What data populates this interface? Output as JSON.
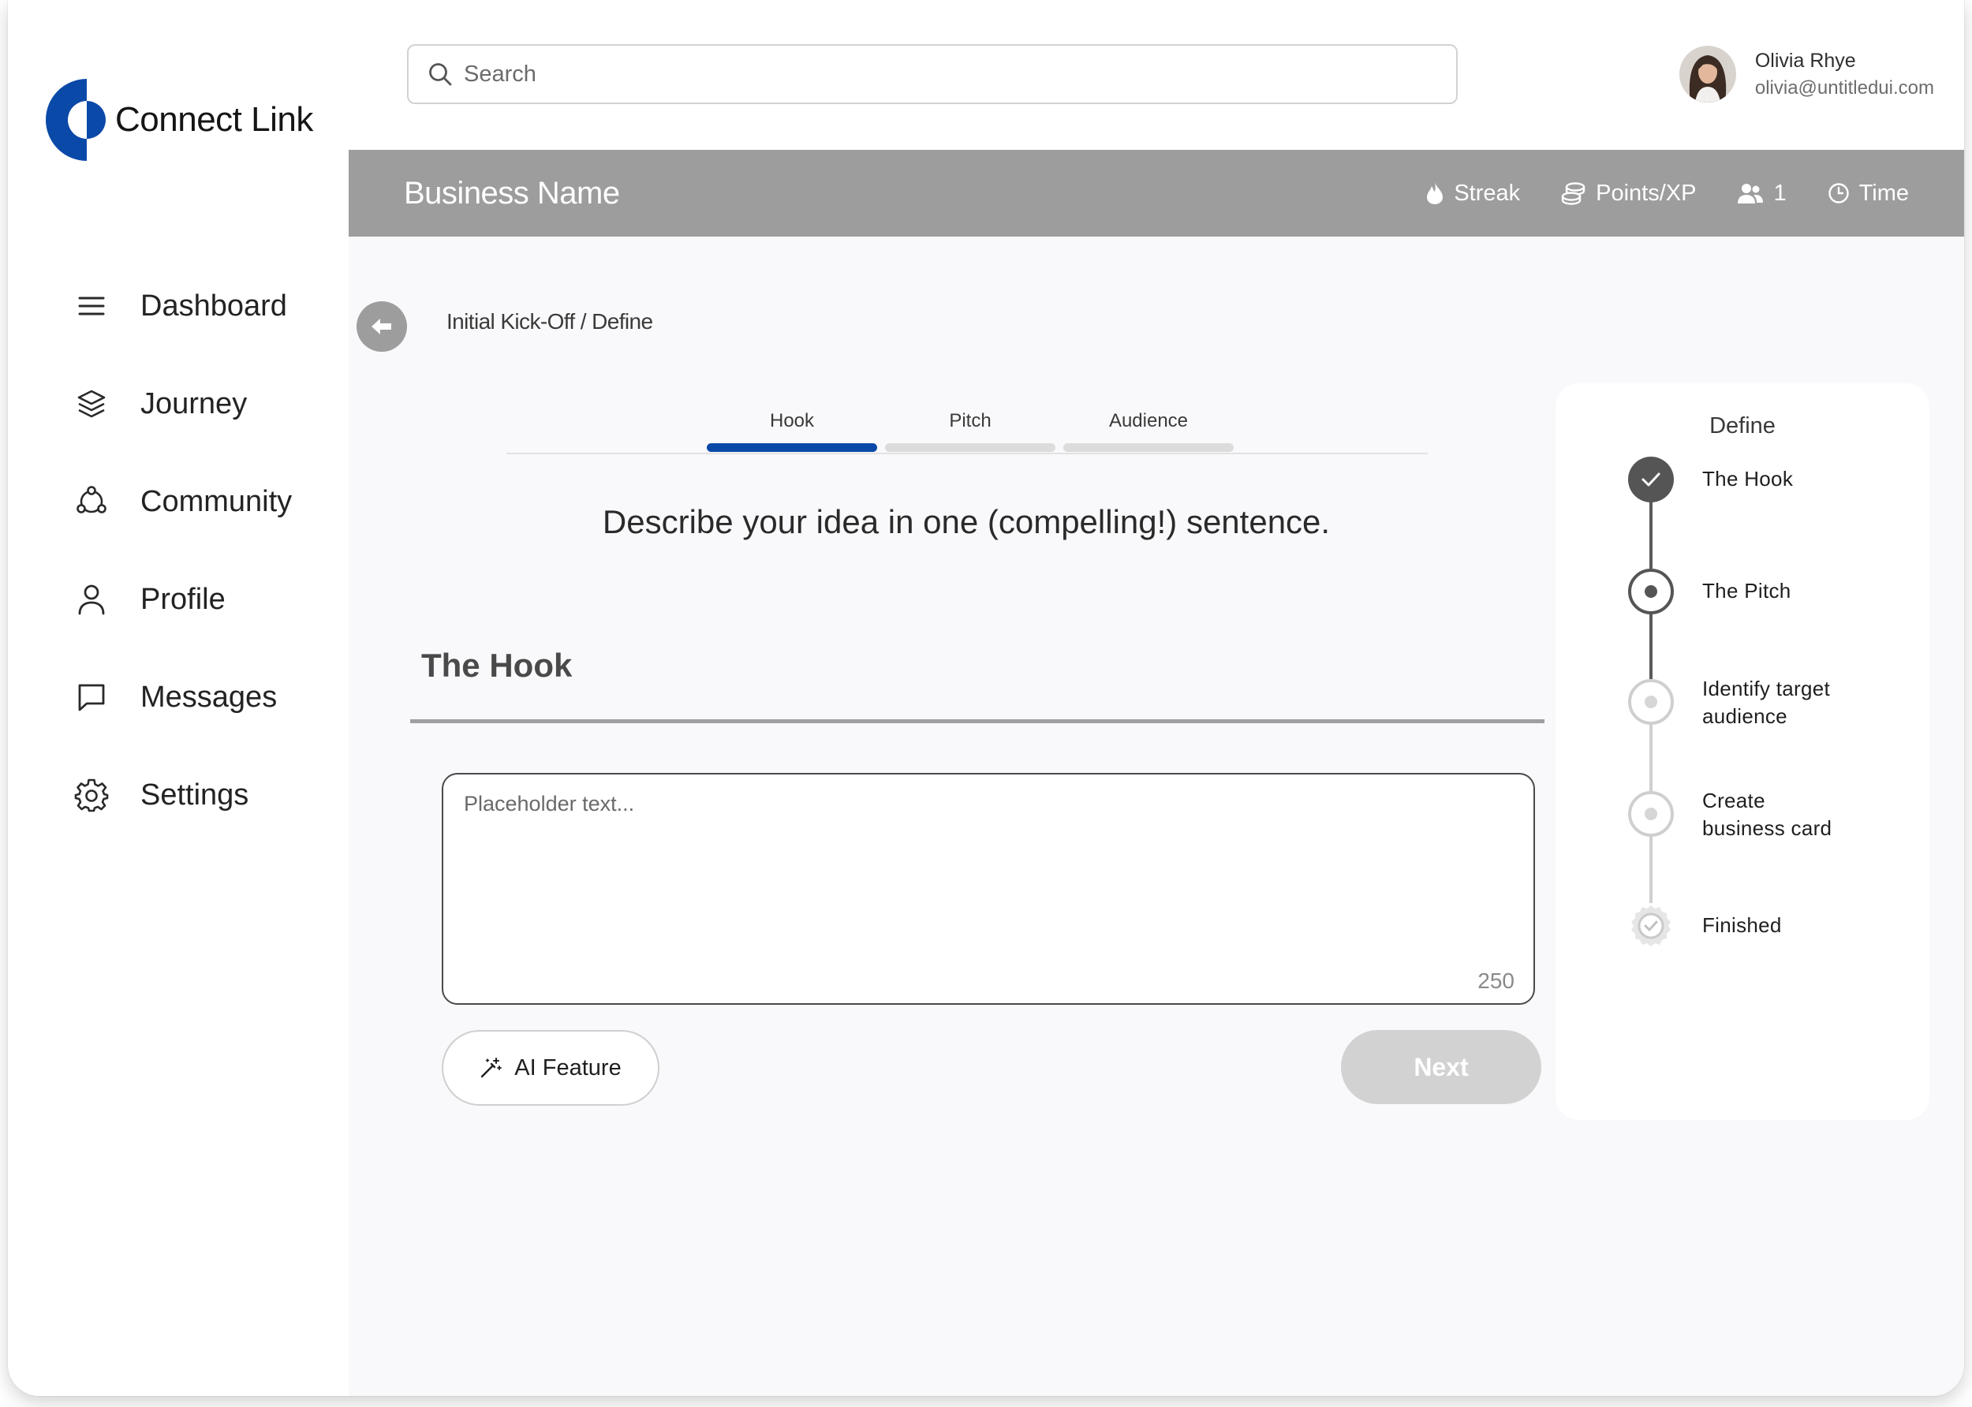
{
  "brand": {
    "name": "Connect Link",
    "color": "#0b49a8"
  },
  "search": {
    "placeholder": "Search"
  },
  "user": {
    "name": "Olivia Rhye",
    "email": "olivia@untitledui.com"
  },
  "sidebar": {
    "items": [
      {
        "label": "Dashboard",
        "icon": "menu-icon"
      },
      {
        "label": "Journey",
        "icon": "layers-icon"
      },
      {
        "label": "Community",
        "icon": "community-icon"
      },
      {
        "label": "Profile",
        "icon": "user-icon"
      },
      {
        "label": "Messages",
        "icon": "message-icon"
      },
      {
        "label": "Settings",
        "icon": "gear-icon"
      }
    ]
  },
  "header": {
    "title": "Business Name",
    "stats": {
      "streak": "Streak",
      "points": "Points/XP",
      "users": "1",
      "time": "Time"
    }
  },
  "breadcrumb": "Initial Kick-Off / Define",
  "tabs": [
    {
      "label": "Hook",
      "active": true
    },
    {
      "label": "Pitch",
      "active": false
    },
    {
      "label": "Audience",
      "active": false
    }
  ],
  "question": "Describe your idea in one (compelling!) sentence.",
  "section_title": "The Hook",
  "textarea": {
    "placeholder": "Placeholder text...",
    "char_count": "250"
  },
  "buttons": {
    "ai_feature": "AI Feature",
    "next": "Next"
  },
  "stepper": {
    "title": "Define",
    "steps": [
      {
        "line1": "The Hook",
        "line2": "",
        "state": "completed"
      },
      {
        "line1": "The Pitch",
        "line2": "",
        "state": "current"
      },
      {
        "line1": "Identify target",
        "line2": "audience",
        "state": "upcoming"
      },
      {
        "line1": "Create",
        "line2": "business card",
        "state": "upcoming"
      },
      {
        "line1": "Finished",
        "line2": "",
        "state": "finish"
      }
    ]
  }
}
